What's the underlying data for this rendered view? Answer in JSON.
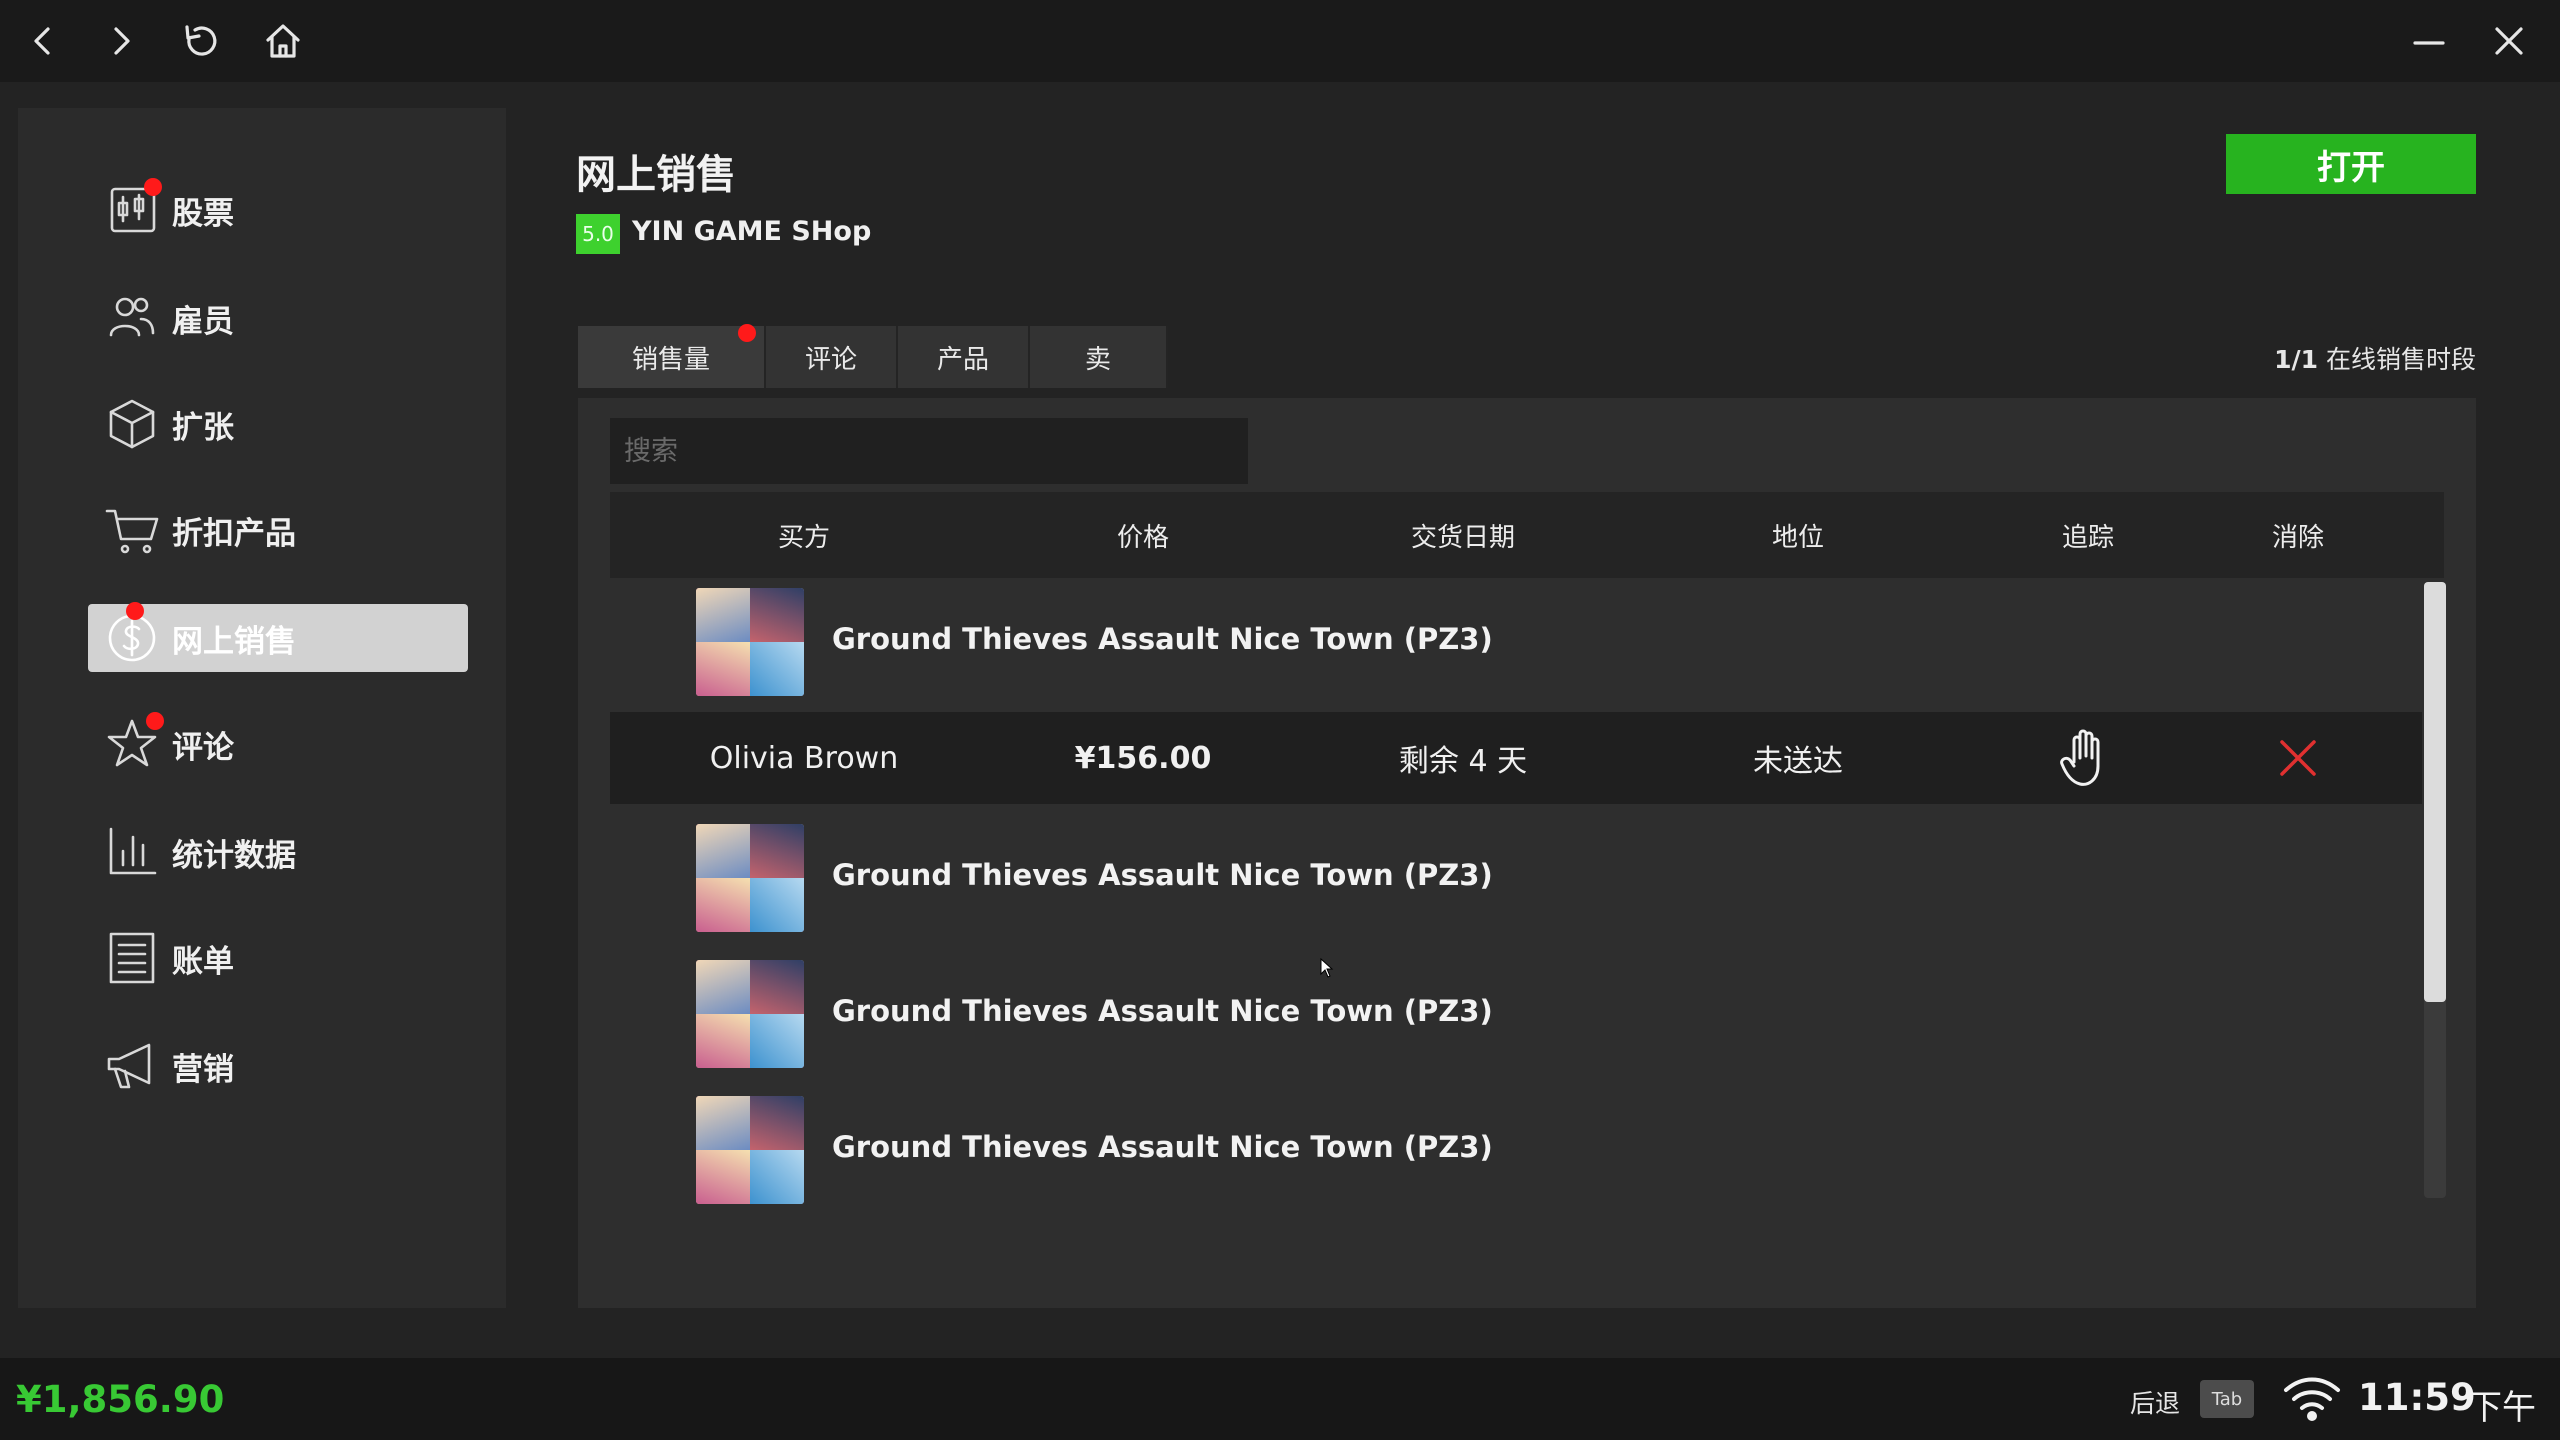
{
  "sidebar": {
    "items": [
      {
        "label": "股票",
        "icon": "stock-chart-icon",
        "badge": true
      },
      {
        "label": "雇员",
        "icon": "employees-icon",
        "badge": false
      },
      {
        "label": "扩张",
        "icon": "box-icon",
        "badge": false
      },
      {
        "label": "折扣产品",
        "icon": "cart-icon",
        "badge": false
      },
      {
        "label": "网上销售",
        "icon": "dollar-icon",
        "badge": true,
        "active": true
      },
      {
        "label": "评论",
        "icon": "star-icon",
        "badge": true
      },
      {
        "label": "统计数据",
        "icon": "bar-chart-icon",
        "badge": false
      },
      {
        "label": "账单",
        "icon": "receipt-icon",
        "badge": false
      },
      {
        "label": "营销",
        "icon": "megaphone-icon",
        "badge": false
      }
    ]
  },
  "header": {
    "title": "网上销售",
    "rating": "5.0",
    "shop_name": "YIN GAME SHop",
    "open_button": "打开"
  },
  "tabs": [
    {
      "label": "销售量",
      "active": true,
      "badge": true
    },
    {
      "label": "评论",
      "active": false,
      "badge": false
    },
    {
      "label": "产品",
      "active": false,
      "badge": false
    },
    {
      "label": "卖",
      "active": false,
      "badge": false
    }
  ],
  "period": {
    "count": "1/1",
    "label": "在线销售时段"
  },
  "search": {
    "placeholder": "搜索",
    "value": ""
  },
  "table": {
    "columns": [
      "买方",
      "价格",
      "交货日期",
      "地位",
      "追踪",
      "消除"
    ],
    "product_name": "Ground Thieves Assault Nice Town (PZ3)",
    "order": {
      "buyer": "Olivia Brown",
      "price": "¥156.00",
      "delivery": "剩余 4 天",
      "status": "未送达",
      "track_icon": "hand-icon",
      "delete_icon": "close-icon"
    },
    "products": [
      "Ground Thieves Assault Nice Town (PZ3)",
      "Ground Thieves Assault Nice Town (PZ3)",
      "Ground Thieves Assault Nice Town (PZ3)",
      "Ground Thieves Assault Nice Town (PZ3)"
    ]
  },
  "footer": {
    "money": "¥1,856.90",
    "back_label": "后退",
    "tab_key": "Tab",
    "time": "11:59",
    "ampm": "下午"
  },
  "colors": {
    "accent_green": "#27b31f",
    "money_green": "#38c934",
    "badge_red": "#ff1a1a",
    "delete_red": "#e03030"
  }
}
